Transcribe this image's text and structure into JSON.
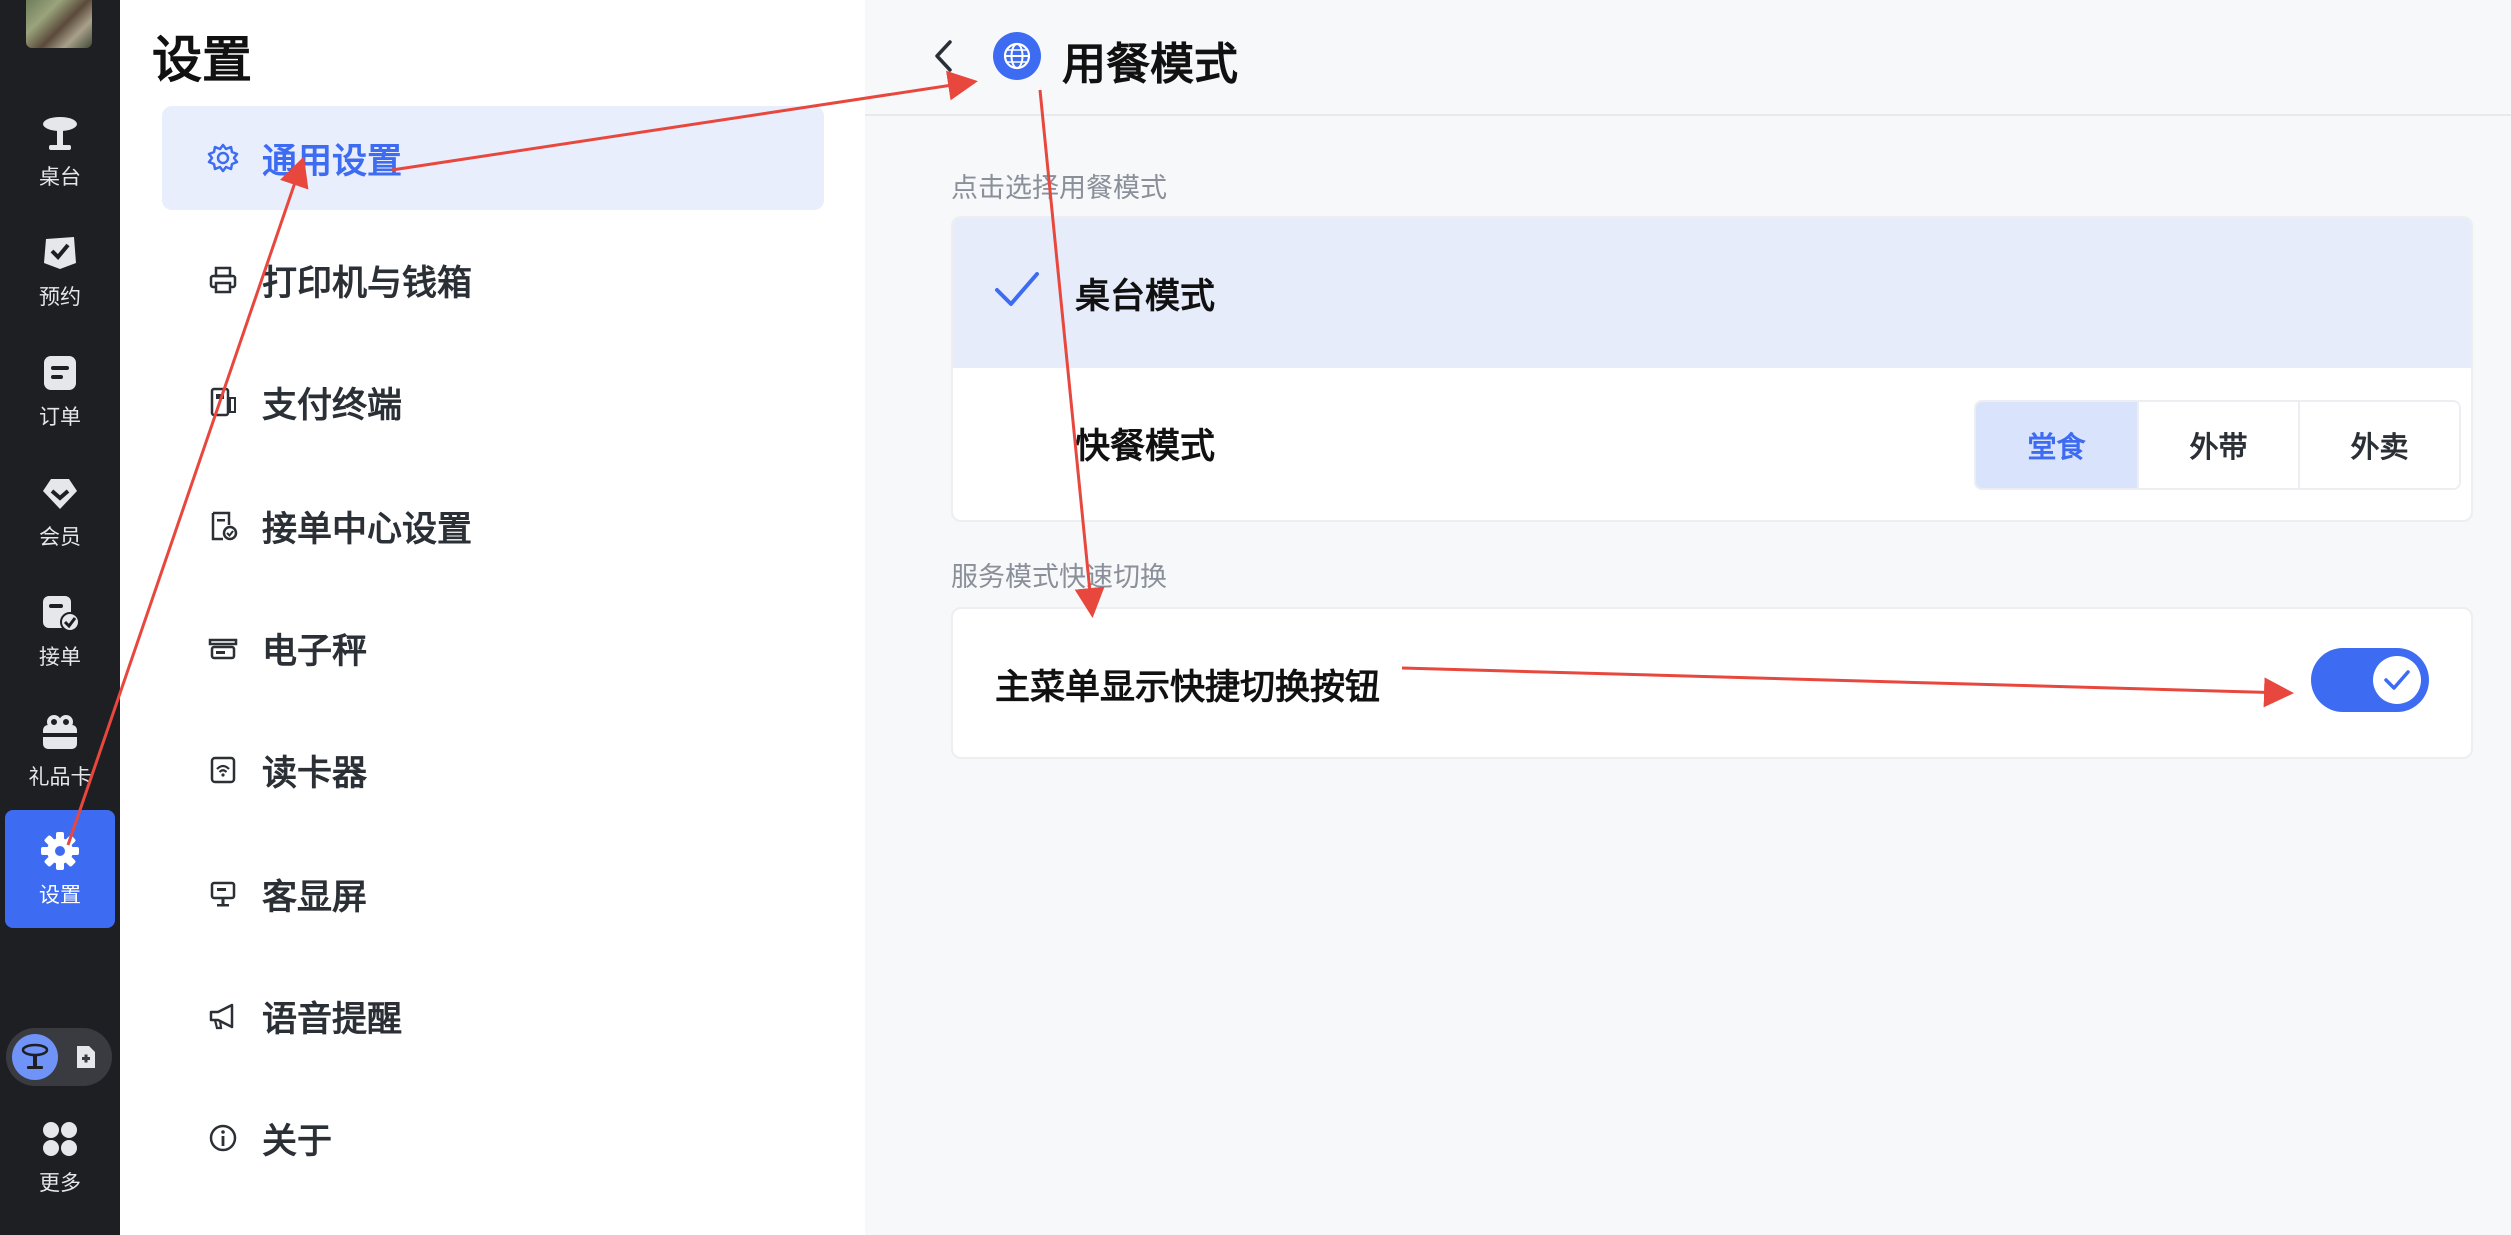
{
  "rail": {
    "items": [
      {
        "label": "桌台",
        "icon": "table-icon"
      },
      {
        "label": "预约",
        "icon": "reservation-icon"
      },
      {
        "label": "订单",
        "icon": "order-icon"
      },
      {
        "label": "会员",
        "icon": "member-icon"
      },
      {
        "label": "接单",
        "icon": "accept-order-icon"
      },
      {
        "label": "礼品卡",
        "icon": "gift-card-icon"
      },
      {
        "label": "设置",
        "icon": "settings-gear-icon",
        "active": true
      }
    ],
    "more_label": "更多"
  },
  "settings": {
    "title": "设置",
    "menu": [
      {
        "label": "通用设置",
        "icon": "gear-icon",
        "active": true
      },
      {
        "label": "打印机与钱箱",
        "icon": "printer-icon"
      },
      {
        "label": "支付终端",
        "icon": "payment-terminal-icon"
      },
      {
        "label": "接单中心设置",
        "icon": "order-center-icon"
      },
      {
        "label": "电子秤",
        "icon": "scale-icon"
      },
      {
        "label": "读卡器",
        "icon": "card-reader-icon"
      },
      {
        "label": "客显屏",
        "icon": "customer-display-icon"
      },
      {
        "label": "语音提醒",
        "icon": "megaphone-icon"
      },
      {
        "label": "关于",
        "icon": "info-icon"
      }
    ]
  },
  "detail": {
    "title": "用餐模式",
    "dining_section_label": "点击选择用餐模式",
    "options": [
      {
        "label": "桌台模式",
        "selected": true
      },
      {
        "label": "快餐模式",
        "selected": false
      }
    ],
    "fast_food_segments": [
      {
        "label": "堂食",
        "selected": true
      },
      {
        "label": "外带",
        "selected": false
      },
      {
        "label": "外卖",
        "selected": false
      }
    ],
    "switch_section_label": "服务模式快速切换",
    "quick_switch_label": "主菜单显示快捷切换按钮",
    "quick_switch_on": true
  },
  "colors": {
    "accent": "#3d6cf2",
    "annotation_arrow": "#e8473d",
    "rail_bg": "#1e1f23"
  }
}
